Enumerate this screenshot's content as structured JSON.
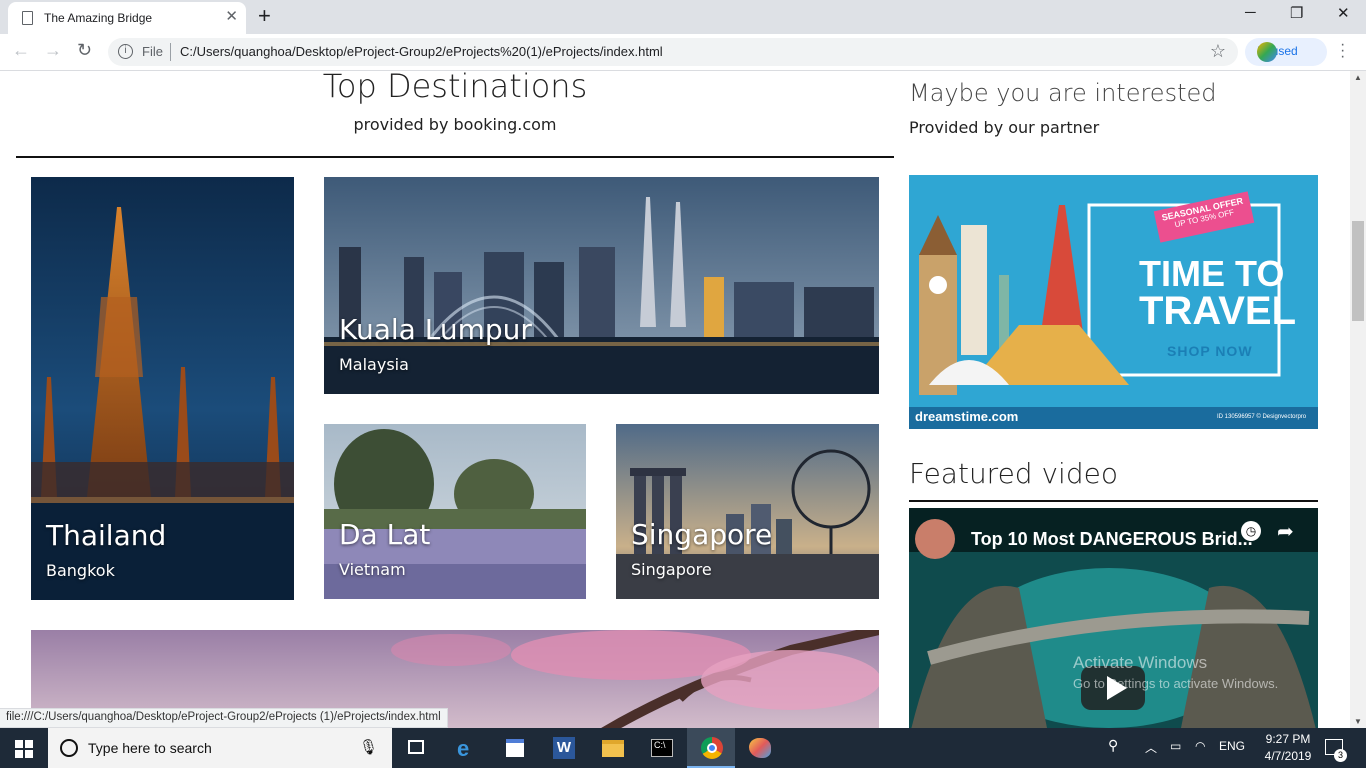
{
  "browser": {
    "tab_title": "The Amazing Bridge",
    "new_tab": "+",
    "url_scheme_label": "File",
    "url": "C:/Users/quanghoa/Desktop/eProject-Group2/eProjects%20(1)/eProjects/index.html",
    "profile_status": "Paused",
    "status_url": "file:///C:/Users/quanghoa/Desktop/eProject-Group2/eProjects (1)/eProjects/index.html"
  },
  "main": {
    "title": "Top Destinations",
    "subtitle": "provided by booking.com",
    "destinations": [
      {
        "city": "Thailand",
        "country": "Bangkok"
      },
      {
        "city": "Kuala Lumpur",
        "country": "Malaysia"
      },
      {
        "city": "Da Lat",
        "country": "Vietnam"
      },
      {
        "city": "Singapore",
        "country": "Singapore"
      }
    ]
  },
  "sidebar": {
    "title": "Maybe you are interested",
    "subtitle": "Provided by our partner",
    "ad": {
      "badge_line1": "SEASONAL OFFER",
      "badge_line2": "UP TO 35% OFF",
      "headline1": "TIME TO",
      "headline2": "TRAVEL",
      "cta": "SHOP NOW",
      "watermark": "dreamstime.com",
      "id_text": "ID 130596957 © Designvectorpro"
    },
    "video_heading": "Featured video",
    "video": {
      "title": "Top 10 Most DANGEROUS Brid...",
      "overlay_line1": "Activate Windows",
      "overlay_line2": "Go to Settings to activate Windows."
    }
  },
  "taskbar": {
    "search_placeholder": "Type here to search",
    "language": "ENG",
    "time": "9:27 PM",
    "date": "4/7/2019",
    "notifications": "3"
  },
  "colors": {
    "tabstrip": "#dee1e6",
    "taskbar": "#1e2a38",
    "ad_bg": "#2fa6d3",
    "ad_pink": "#ec4f8f"
  }
}
